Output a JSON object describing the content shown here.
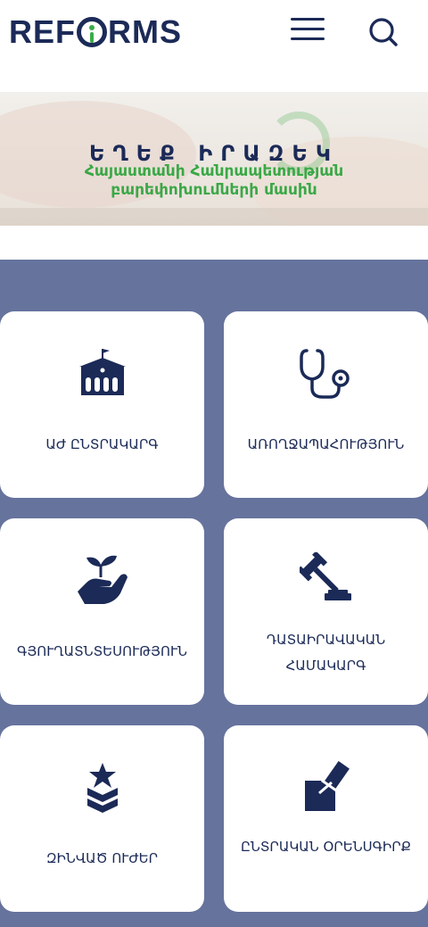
{
  "header": {
    "logo_text_left": "R",
    "logo_text_e": "E",
    "logo_text_f": "F",
    "logo_text_right": "RMS",
    "logo_alt": "REFORMS",
    "menu_icon": "hamburger-icon",
    "search_icon": "search-icon"
  },
  "banner": {
    "title": "ԵՂԵՔ ԻՐԱԶԵԿ",
    "subtitle_line1": "Հայաստանի Հանրապետության",
    "subtitle_line2": "բարեփոխումների մասին"
  },
  "categories": [
    {
      "label": "ԱԺ ԸՆՏՐԱԿԱՐԳ",
      "icon": "government-building-icon"
    },
    {
      "label": "ԱՌՈՂՋԱՊԱՀՈՒԹՅՈՒՆ",
      "icon": "stethoscope-icon"
    },
    {
      "label": "ԳՅՈՒՂԱՏՆՏԵՍՈՒԹՅՈՒՆ",
      "icon": "hand-plant-icon"
    },
    {
      "label": "ԴԱՏԱԻՐԱՎԱԿԱՆ ՀԱՄԱԿԱՐԳ",
      "icon": "gavel-icon"
    },
    {
      "label": "ԶԻՆՎԱԾ ՈՒԺԵՐ",
      "icon": "military-rank-icon"
    },
    {
      "label": "ԸՆՏՐԱԿԱՆ ՕՐԵՆՍԳԻՐՔ",
      "icon": "ballot-box-icon"
    }
  ],
  "colors": {
    "navy": "#1b2a57",
    "green": "#3aa846",
    "section_bg": "#66739d"
  }
}
